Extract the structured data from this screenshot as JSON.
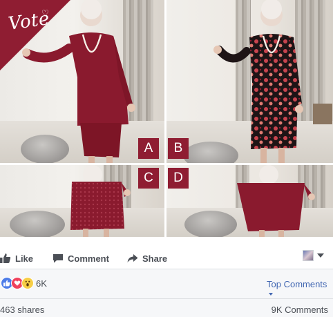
{
  "post_image": {
    "banner_text": "Vote",
    "options": [
      {
        "letter": "A",
        "outfit": "burgundy top and skirt"
      },
      {
        "letter": "B",
        "outfit": "floral print dress"
      },
      {
        "letter": "C",
        "outfit": "burgundy lace dress"
      },
      {
        "letter": "D",
        "outfit": "burgundy dress"
      }
    ],
    "accent_color": "#8f1d32"
  },
  "actions": {
    "like_label": "Like",
    "comment_label": "Comment",
    "share_label": "Share"
  },
  "reactions": {
    "icons": [
      "like-icon",
      "love-icon",
      "wow-icon"
    ],
    "count": "6K",
    "sort_label": "Top Comments"
  },
  "stats": {
    "shares": "463 shares",
    "comments": "9K Comments"
  },
  "colors": {
    "link_blue": "#4267b2",
    "text_gray": "#4b4f56",
    "bar_background": "#f6f7f9"
  }
}
